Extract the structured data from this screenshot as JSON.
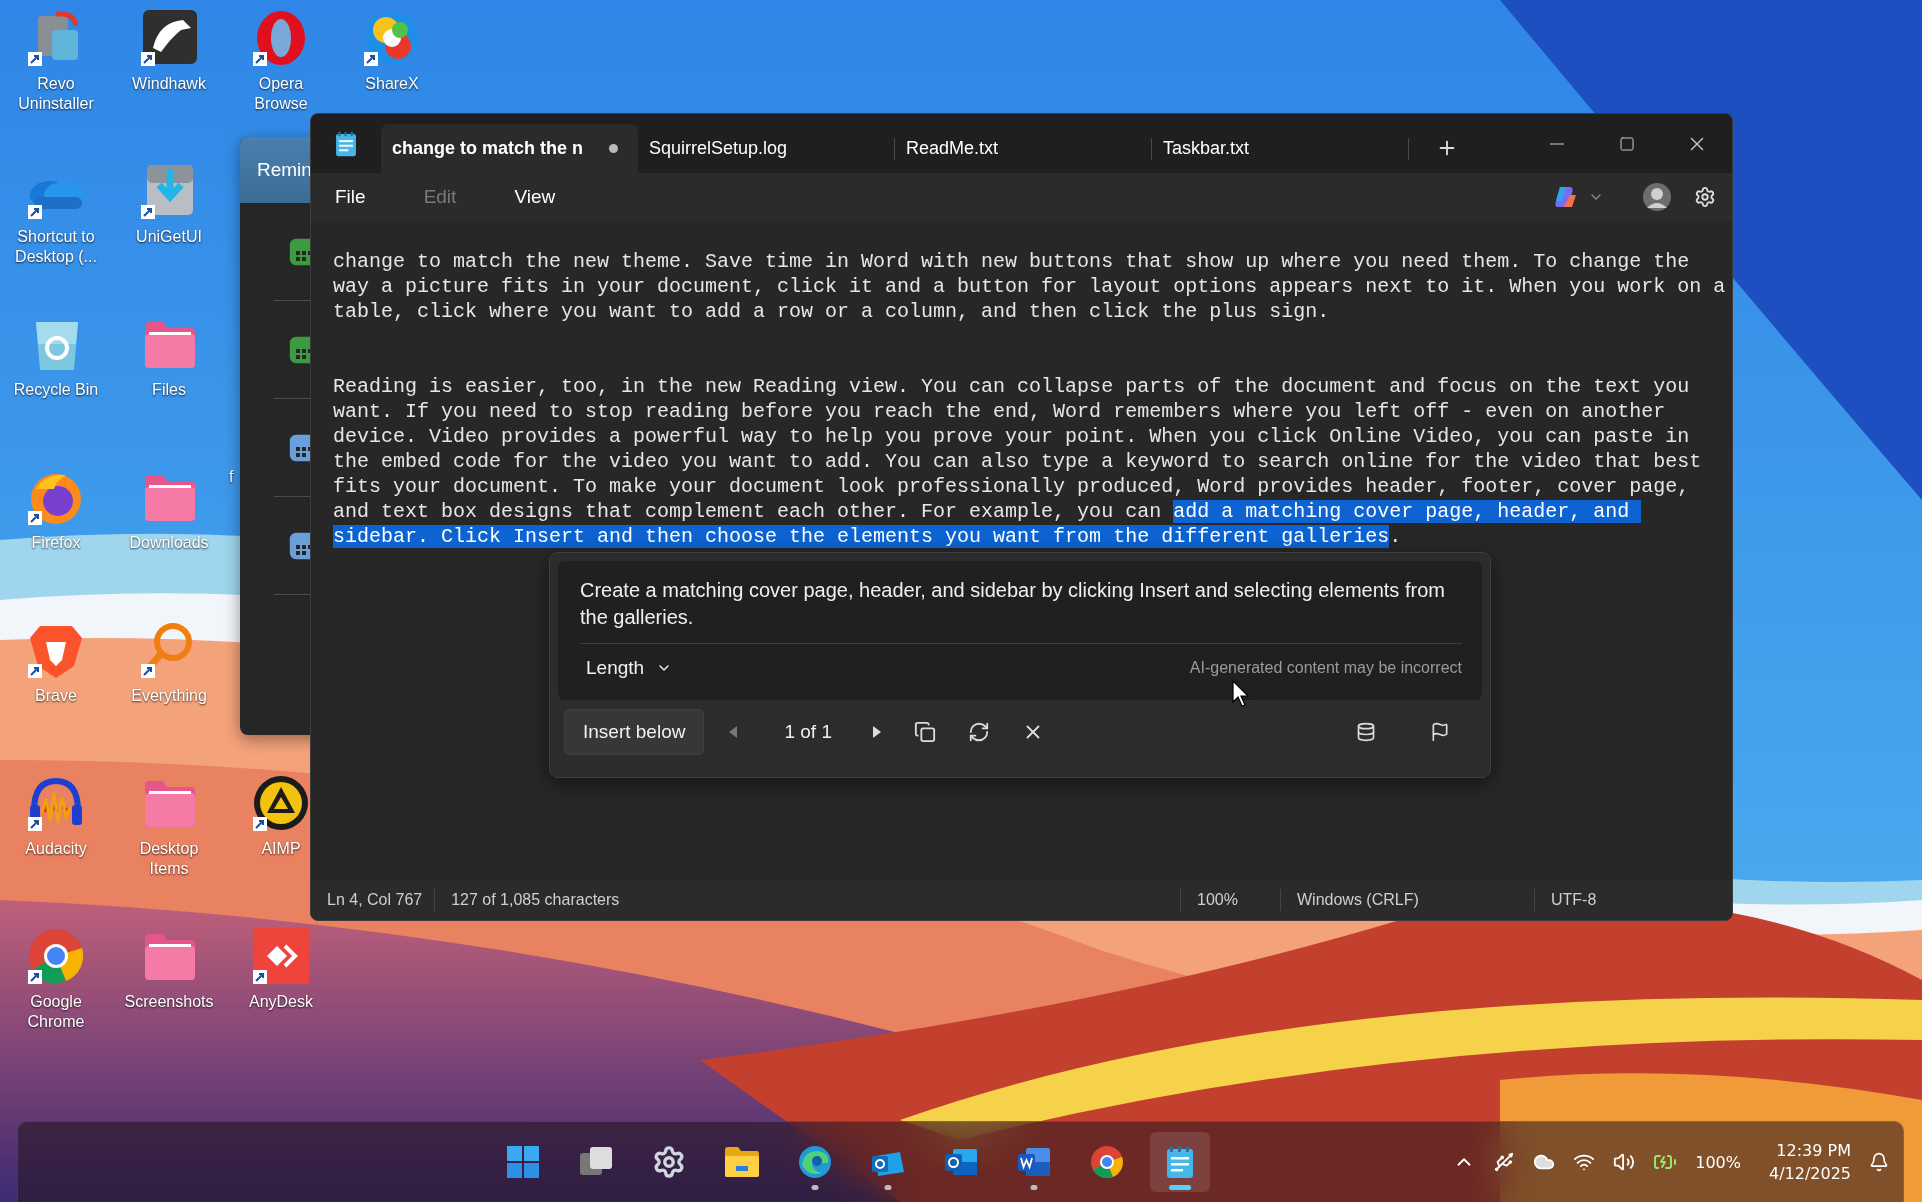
{
  "desktop": {
    "rows": [
      [
        {
          "kind": "revo",
          "label": "Revo Uninstaller",
          "shortcut": true
        },
        {
          "kind": "windhawk",
          "label": "Windhawk",
          "shortcut": true
        },
        {
          "kind": "opera",
          "label": "Opera Browse",
          "shortcut": true
        },
        {
          "kind": "sharex",
          "label": "ShareX",
          "shortcut": true
        }
      ],
      [
        {
          "kind": "onedrive",
          "label": "Shortcut to Desktop (...",
          "shortcut": true
        },
        {
          "kind": "unigetui",
          "label": "UniGetUI",
          "shortcut": true
        }
      ],
      [
        {
          "kind": "recycle_bin",
          "label": "Recycle Bin",
          "shortcut": false
        },
        {
          "kind": "folder",
          "label": "Files",
          "shortcut": false
        }
      ],
      [
        {
          "kind": "firefox",
          "label": "Firefox",
          "shortcut": true
        },
        {
          "kind": "folder",
          "label": "Downloads",
          "shortcut": false
        },
        {
          "kind": "label_only",
          "label": "f"
        }
      ],
      [
        {
          "kind": "brave",
          "label": "Brave",
          "shortcut": true
        },
        {
          "kind": "everything",
          "label": "Everything",
          "shortcut": true
        }
      ],
      [
        {
          "kind": "audacity",
          "label": "Audacity",
          "shortcut": true
        },
        {
          "kind": "folder",
          "label": "Desktop Items",
          "shortcut": false
        },
        {
          "kind": "aimp",
          "label": "AIMP",
          "shortcut": true
        }
      ],
      [
        {
          "kind": "chrome",
          "label": "Google Chrome",
          "shortcut": true
        },
        {
          "kind": "folder",
          "label": "Screenshots",
          "shortcut": false
        },
        {
          "kind": "anydesk",
          "label": "AnyDesk",
          "shortcut": true
        }
      ]
    ]
  },
  "reminders_window": {
    "title": "Remin",
    "items": [
      {
        "color": "#3c9a40"
      },
      {
        "color": "#3c9a40"
      },
      {
        "color": "#6b9fd9"
      },
      {
        "color": "#6b9fd9"
      }
    ]
  },
  "notepad": {
    "tabs": [
      {
        "title": "change to match the n",
        "selected": true,
        "modified": true
      },
      {
        "title": "SquirrelSetup.log",
        "selected": false,
        "modified": false
      },
      {
        "title": "ReadMe.txt",
        "selected": false,
        "modified": false
      },
      {
        "title": "Taskbar.txt",
        "selected": false,
        "modified": false
      }
    ],
    "menu": [
      {
        "label": "File",
        "disabled": false
      },
      {
        "label": "Edit",
        "disabled": true
      },
      {
        "label": "View",
        "disabled": false
      }
    ],
    "paragraphs": [
      {
        "lines": [
          [
            {
              "text": "change to match the new theme. Save time in Word with new buttons that show up where you need them. To change the",
              "selected": false
            }
          ],
          [
            {
              "text": "way a picture fits in your document, click it and a button for layout options appears next to it. When you work on a",
              "selected": false
            }
          ],
          [
            {
              "text": "table, click where you want to add a row or a column, and then click the plus sign.",
              "selected": false
            }
          ]
        ]
      },
      {
        "lines": [
          [
            {
              "text": "Reading is easier, too, in the new Reading view. You can collapse parts of the document and focus on the text you",
              "selected": false
            }
          ],
          [
            {
              "text": "want. If you need to stop reading before you reach the end, Word remembers where you left off - even on another",
              "selected": false
            }
          ],
          [
            {
              "text": "device. Video provides a powerful way to help you prove your point. When you click Online Video, you can paste in",
              "selected": false
            }
          ],
          [
            {
              "text": "the embed code for the video you want to add. You can also type a keyword to search online for the video that best",
              "selected": false
            }
          ],
          [
            {
              "text": "fits your document. To make your document look professionally produced, Word provides header, footer, cover page,",
              "selected": false
            }
          ],
          [
            {
              "text": "and text box designs that complement each other. For example, you can ",
              "selected": false
            },
            {
              "text": "add a matching cover page, header, and ",
              "selected": true
            }
          ],
          [
            {
              "text": "sidebar. Click Insert and then choose the elements you want from the different galleries",
              "selected": true
            },
            {
              "text": ".",
              "selected": false
            }
          ]
        ]
      }
    ],
    "rewrite_popup": {
      "text": "Create a matching cover page, header, and sidebar by clicking Insert and selecting elements from the galleries.",
      "length_label": "Length",
      "disclaimer": "AI-generated content may be incorrect",
      "insert_button": "Insert below",
      "counter": "1 of 1",
      "prev_disabled": true,
      "next_disabled": false
    },
    "status_bar": {
      "position": "Ln 4, Col 767",
      "characters": "127 of 1,085 characters",
      "zoom": "100%",
      "line_ending": "Windows (CRLF)",
      "encoding": "UTF-8"
    }
  },
  "taskbar": {
    "items": [
      {
        "kind": "start",
        "running": false,
        "active": false
      },
      {
        "kind": "task_view",
        "running": false,
        "active": false
      },
      {
        "kind": "settings",
        "running": false,
        "active": false
      },
      {
        "kind": "explorer",
        "running": false,
        "active": false
      },
      {
        "kind": "edge",
        "running": true,
        "active": false
      },
      {
        "kind": "outlook_new",
        "running": true,
        "active": false
      },
      {
        "kind": "outlook",
        "running": false,
        "active": false
      },
      {
        "kind": "word",
        "running": true,
        "active": false
      },
      {
        "kind": "chrome",
        "running": false,
        "active": false
      },
      {
        "kind": "notepad",
        "running": true,
        "active": true
      }
    ],
    "tray": {
      "battery": "100%",
      "time": "12:39 PM",
      "date": "4/12/2025"
    }
  }
}
